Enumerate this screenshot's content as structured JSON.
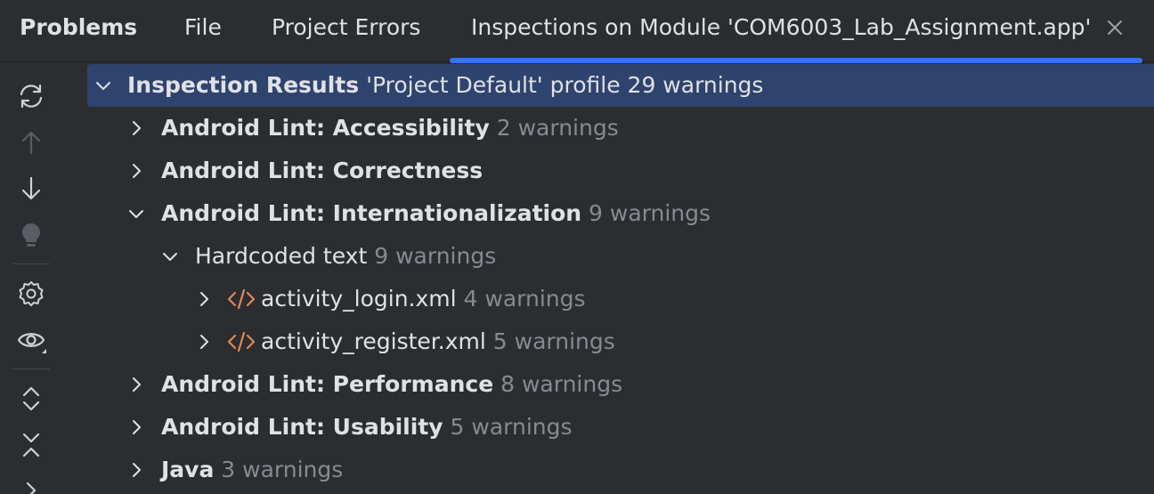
{
  "header": {
    "title": "Problems",
    "tabs": [
      {
        "label": "File"
      },
      {
        "label": "Project Errors"
      },
      {
        "label": "Inspections on Module 'COM6003_Lab_Assignment.app'"
      }
    ]
  },
  "toolbar": {
    "icons": [
      "refresh-icon",
      "arrow-up-icon",
      "arrow-down-icon",
      "bulb-icon",
      "gear-icon",
      "eye-icon",
      "expand-all-icon",
      "collapse-all-icon",
      "chevron-right-icon"
    ]
  },
  "tree": {
    "root": {
      "label": "Inspection Results",
      "profile": "'Project Default' profile",
      "count": "29 warnings"
    },
    "groups": [
      {
        "label": "Android Lint: Accessibility",
        "count": "2 warnings"
      },
      {
        "label": "Android Lint: Correctness",
        "count": ""
      },
      {
        "label": "Android Lint: Internationalization",
        "count": "9 warnings"
      },
      {
        "label": "Android Lint: Performance",
        "count": "8 warnings"
      },
      {
        "label": "Android Lint: Usability",
        "count": "5 warnings"
      },
      {
        "label": "Java",
        "count": "3 warnings"
      }
    ],
    "subgroup": {
      "label": "Hardcoded text",
      "count": "9 warnings"
    },
    "files": [
      {
        "label": "activity_login.xml",
        "count": "4 warnings"
      },
      {
        "label": "activity_register.xml",
        "count": "5 warnings"
      }
    ]
  },
  "colors": {
    "background": "#2b2d30",
    "selection": "#2e436e",
    "accent": "#3574f0",
    "muted_text": "#868a91",
    "xml_icon": "#e08855"
  }
}
